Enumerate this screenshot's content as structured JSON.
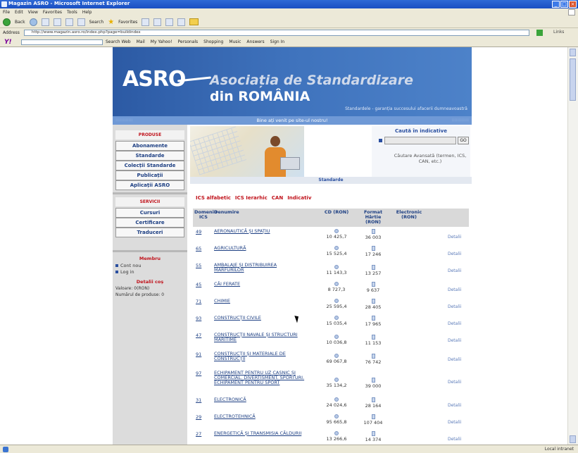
{
  "window": {
    "title": "Magazin ASRO - Microsoft Internet Explorer"
  },
  "menu": [
    "File",
    "Edit",
    "View",
    "Favorites",
    "Tools",
    "Help"
  ],
  "toolbar": {
    "back": "Back",
    "search": "Search",
    "favorites": "Favorites"
  },
  "address": {
    "label": "Address",
    "url": "http://www.magazin.asro.ro/index.php?page=buildindex",
    "go": "Go",
    "links": "Links"
  },
  "yahoo": {
    "logo": "Y!",
    "search_web": "Search Web",
    "mail": "Mail",
    "my_yahoo": "My Yahoo!",
    "personals": "Personals",
    "shopping": "Shopping",
    "music": "Music",
    "answers": "Answers",
    "sign_in": "Sign In"
  },
  "site": {
    "logo": "ASRO",
    "org_line1": "Asociația de Standardizare",
    "org_line2": "din ROMÂNIA",
    "slogan": "Standardele - garanția succesului afacerii dumneavoastră",
    "welcome": "Bine ați venit pe site-ul nostru!"
  },
  "nav": {
    "produse": "PRODUSE",
    "items1": [
      "Abonamente",
      "Standarde",
      "Colecții Standarde",
      "Publicații",
      "Aplicații ASRO"
    ],
    "servicii": "SERVICII",
    "items2": [
      "Cursuri",
      "Certificare",
      "Traduceri"
    ],
    "membru": "Membru",
    "cont_nou": "Cont nou",
    "log_in": "Log in",
    "detalii_cos": "Detalii coș",
    "valoare": "Valoare: 0(RON)",
    "numar_produse": "Numărul de produse: 0"
  },
  "search": {
    "title": "Caută în indicative",
    "go": "GO",
    "advanced": "Căutare Avansată (termen, ICS, CAN, etc.)"
  },
  "banner_caption": "Standarde",
  "tabs": {
    "ics_alfabetic": "ICS alfabetic",
    "ics_ierarhic": "ICS Ierarhic",
    "can": "CAN",
    "indicativ": "Indicativ"
  },
  "table": {
    "headers": {
      "domeniu": "Domeniu ICS",
      "denumire": "Denumire",
      "cd": "CD (RON)",
      "hartie": "Format Hârtie (RON)",
      "electronic": "Electronic (RON)"
    },
    "detail_label": "Detalii",
    "rows": [
      {
        "code": "49",
        "name": "AERONAUTICĂ ȘI SPAȚIU",
        "cd": "10 425,7",
        "paper": "36 003"
      },
      {
        "code": "65",
        "name": "AGRICULTURĂ",
        "cd": "15 525,4",
        "paper": "17 246"
      },
      {
        "code": "55",
        "name": "AMBALAJE ȘI DISTRIBUIREA MĂRFURILOR",
        "cd": "11 143,3",
        "paper": "13 257"
      },
      {
        "code": "45",
        "name": "CĂI FERATE",
        "cd": "8 727,3",
        "paper": "9 637"
      },
      {
        "code": "71",
        "name": "CHIMIE",
        "cd": "25 595,4",
        "paper": "28 405"
      },
      {
        "code": "93",
        "name": "CONSTRUCȚII CIVILE",
        "cd": "15 035,4",
        "paper": "17 965"
      },
      {
        "code": "47",
        "name": "CONSTRUCȚII NAVALE ȘI STRUCTURI MARITIME",
        "cd": "10 036,8",
        "paper": "11 153"
      },
      {
        "code": "91",
        "name": "CONSTRUCȚII ȘI MATERIALE DE CONSTRUCȚII",
        "cd": "69 067,8",
        "paper": "76 742"
      },
      {
        "code": "97",
        "name": "ECHIPAMENT PENTRU UZ CASNIC ȘI COMERCIAL. DIVERTISMENT. SPORTURI. ECHIPAMENT PENTRU SPORT",
        "cd": "35 134,2",
        "paper": "39 000"
      },
      {
        "code": "31",
        "name": "ELECTRONICĂ",
        "cd": "24 024,6",
        "paper": "28 164"
      },
      {
        "code": "29",
        "name": "ELECTROTEHNICĂ",
        "cd": "95 665,8",
        "paper": "107 404"
      },
      {
        "code": "27",
        "name": "ENERGETICĂ ȘI TRANSMISIA CĂLDURII",
        "cd": "13 266,6",
        "paper": "14 374"
      }
    ]
  },
  "status": {
    "zone": "Local intranet"
  }
}
